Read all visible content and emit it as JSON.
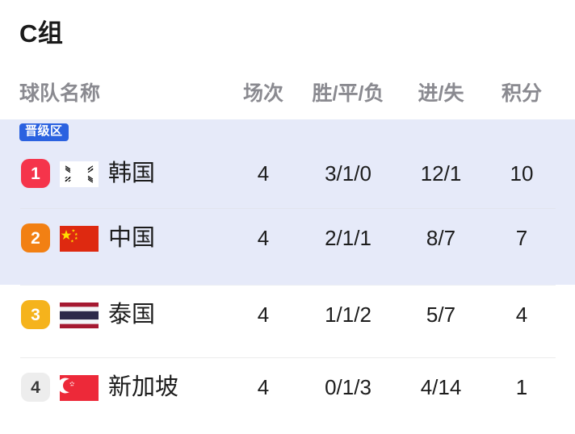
{
  "group": {
    "title": "C组"
  },
  "columns": {
    "team": "球队名称",
    "played": "场次",
    "wdl": "胜/平/负",
    "goals": "进/失",
    "points": "积分"
  },
  "zone": {
    "label": "晋级区",
    "badge_color": "#2b62e0",
    "band_color": "#e6eaf9"
  },
  "rows": [
    {
      "rank": "1",
      "rank_color": "#f5344b",
      "flag": "flag-south-korea",
      "team": "韩国",
      "played": "4",
      "wdl": "3/1/0",
      "goals": "12/1",
      "points": "10"
    },
    {
      "rank": "2",
      "rank_color": "#f28013",
      "flag": "flag-china",
      "team": "中国",
      "played": "4",
      "wdl": "2/1/1",
      "goals": "8/7",
      "points": "7"
    },
    {
      "rank": "3",
      "rank_color": "#f5b31c",
      "flag": "flag-thailand",
      "team": "泰国",
      "played": "4",
      "wdl": "1/1/2",
      "goals": "5/7",
      "points": "4"
    },
    {
      "rank": "4",
      "rank_color": "#ededed",
      "rank_text_color": "#3a3a3a",
      "flag": "flag-singapore",
      "team": "新加坡",
      "played": "4",
      "wdl": "0/1/3",
      "goals": "4/14",
      "points": "1"
    }
  ]
}
